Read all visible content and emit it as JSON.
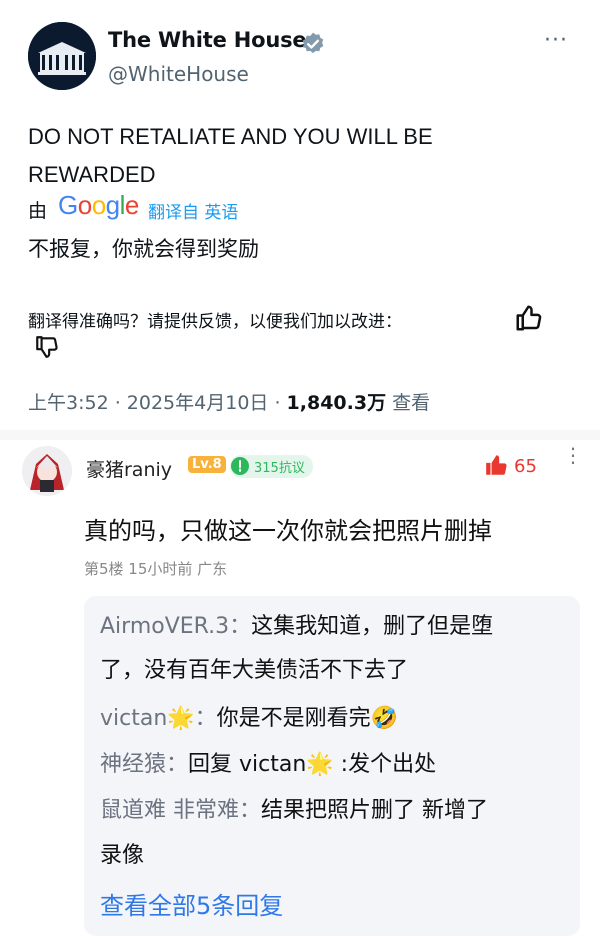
{
  "tweet": {
    "name": "The White House",
    "handle": "@WhiteHouse",
    "more": "···",
    "text_line1": "DO NOT RETALIATE AND YOU WILL BE",
    "text_line2": "REWARDED",
    "by": "由",
    "google": "Google",
    "translated_from": "翻译自 英语",
    "translation": "不报复，你就会得到奖励",
    "feedback": "翻译得准确吗？请提供反馈，以便我们加以改进：",
    "time": "上午3:52 · 2025年4月10日 · ",
    "views": "1,840.3万",
    "views_label": "查看"
  },
  "comment": {
    "user": "豪猪raniy",
    "level": "Lv.8",
    "badge": "315抗议",
    "likes": "65",
    "more": "⋮",
    "text": "真的吗，只做这一次你就会把照片删掉",
    "meta": "第5楼  15小时前  广东"
  },
  "replies": [
    {
      "user": "AirmoVER.3：",
      "text": "这集我知道，删了但是堕"
    },
    {
      "user": "",
      "text": "了，没有百年大美债活不下去了"
    },
    {
      "user": "victan🌟：",
      "text": "你是不是刚看完🤣"
    },
    {
      "user": "神经猿：",
      "text": "回复 victan🌟 :发个出处"
    },
    {
      "user": "鼠道难 非常难：",
      "text": "结果把照片删了 新增了"
    },
    {
      "user": "",
      "text": "录像"
    }
  ],
  "view_all": "查看全部5条回复",
  "colors": {
    "verified": "#829aab",
    "link": "#1d9bf0",
    "like": "#e8382f",
    "reply_link": "#2e78e8"
  },
  "icons": [
    "white-house-logo",
    "verified-badge-icon",
    "thumbs-up-icon",
    "thumbs-down-icon",
    "like-icon",
    "more-icon"
  ]
}
